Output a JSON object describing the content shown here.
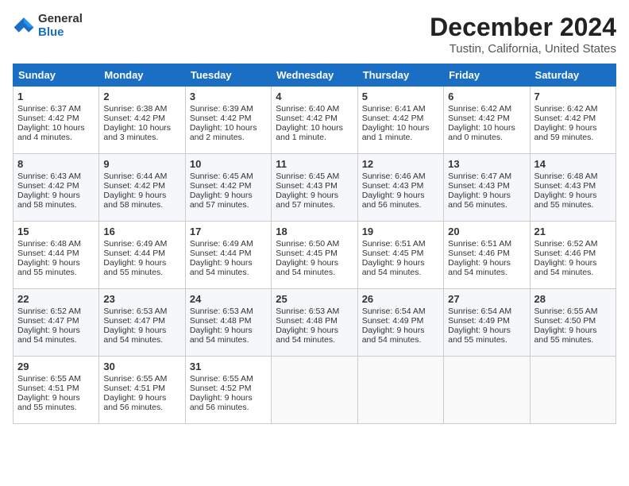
{
  "header": {
    "logo_general": "General",
    "logo_blue": "Blue",
    "title": "December 2024",
    "subtitle": "Tustin, California, United States"
  },
  "days_of_week": [
    "Sunday",
    "Monday",
    "Tuesday",
    "Wednesday",
    "Thursday",
    "Friday",
    "Saturday"
  ],
  "weeks": [
    [
      {
        "day": "1",
        "sunrise": "6:37 AM",
        "sunset": "4:42 PM",
        "daylight": "10 hours and 4 minutes."
      },
      {
        "day": "2",
        "sunrise": "6:38 AM",
        "sunset": "4:42 PM",
        "daylight": "10 hours and 3 minutes."
      },
      {
        "day": "3",
        "sunrise": "6:39 AM",
        "sunset": "4:42 PM",
        "daylight": "10 hours and 2 minutes."
      },
      {
        "day": "4",
        "sunrise": "6:40 AM",
        "sunset": "4:42 PM",
        "daylight": "10 hours and 1 minute."
      },
      {
        "day": "5",
        "sunrise": "6:41 AM",
        "sunset": "4:42 PM",
        "daylight": "10 hours and 1 minute."
      },
      {
        "day": "6",
        "sunrise": "6:42 AM",
        "sunset": "4:42 PM",
        "daylight": "10 hours and 0 minutes."
      },
      {
        "day": "7",
        "sunrise": "6:42 AM",
        "sunset": "4:42 PM",
        "daylight": "9 hours and 59 minutes."
      }
    ],
    [
      {
        "day": "8",
        "sunrise": "6:43 AM",
        "sunset": "4:42 PM",
        "daylight": "9 hours and 58 minutes."
      },
      {
        "day": "9",
        "sunrise": "6:44 AM",
        "sunset": "4:42 PM",
        "daylight": "9 hours and 58 minutes."
      },
      {
        "day": "10",
        "sunrise": "6:45 AM",
        "sunset": "4:42 PM",
        "daylight": "9 hours and 57 minutes."
      },
      {
        "day": "11",
        "sunrise": "6:45 AM",
        "sunset": "4:43 PM",
        "daylight": "9 hours and 57 minutes."
      },
      {
        "day": "12",
        "sunrise": "6:46 AM",
        "sunset": "4:43 PM",
        "daylight": "9 hours and 56 minutes."
      },
      {
        "day": "13",
        "sunrise": "6:47 AM",
        "sunset": "4:43 PM",
        "daylight": "9 hours and 56 minutes."
      },
      {
        "day": "14",
        "sunrise": "6:48 AM",
        "sunset": "4:43 PM",
        "daylight": "9 hours and 55 minutes."
      }
    ],
    [
      {
        "day": "15",
        "sunrise": "6:48 AM",
        "sunset": "4:44 PM",
        "daylight": "9 hours and 55 minutes."
      },
      {
        "day": "16",
        "sunrise": "6:49 AM",
        "sunset": "4:44 PM",
        "daylight": "9 hours and 55 minutes."
      },
      {
        "day": "17",
        "sunrise": "6:49 AM",
        "sunset": "4:44 PM",
        "daylight": "9 hours and 54 minutes."
      },
      {
        "day": "18",
        "sunrise": "6:50 AM",
        "sunset": "4:45 PM",
        "daylight": "9 hours and 54 minutes."
      },
      {
        "day": "19",
        "sunrise": "6:51 AM",
        "sunset": "4:45 PM",
        "daylight": "9 hours and 54 minutes."
      },
      {
        "day": "20",
        "sunrise": "6:51 AM",
        "sunset": "4:46 PM",
        "daylight": "9 hours and 54 minutes."
      },
      {
        "day": "21",
        "sunrise": "6:52 AM",
        "sunset": "4:46 PM",
        "daylight": "9 hours and 54 minutes."
      }
    ],
    [
      {
        "day": "22",
        "sunrise": "6:52 AM",
        "sunset": "4:47 PM",
        "daylight": "9 hours and 54 minutes."
      },
      {
        "day": "23",
        "sunrise": "6:53 AM",
        "sunset": "4:47 PM",
        "daylight": "9 hours and 54 minutes."
      },
      {
        "day": "24",
        "sunrise": "6:53 AM",
        "sunset": "4:48 PM",
        "daylight": "9 hours and 54 minutes."
      },
      {
        "day": "25",
        "sunrise": "6:53 AM",
        "sunset": "4:48 PM",
        "daylight": "9 hours and 54 minutes."
      },
      {
        "day": "26",
        "sunrise": "6:54 AM",
        "sunset": "4:49 PM",
        "daylight": "9 hours and 54 minutes."
      },
      {
        "day": "27",
        "sunrise": "6:54 AM",
        "sunset": "4:49 PM",
        "daylight": "9 hours and 55 minutes."
      },
      {
        "day": "28",
        "sunrise": "6:55 AM",
        "sunset": "4:50 PM",
        "daylight": "9 hours and 55 minutes."
      }
    ],
    [
      {
        "day": "29",
        "sunrise": "6:55 AM",
        "sunset": "4:51 PM",
        "daylight": "9 hours and 55 minutes."
      },
      {
        "day": "30",
        "sunrise": "6:55 AM",
        "sunset": "4:51 PM",
        "daylight": "9 hours and 56 minutes."
      },
      {
        "day": "31",
        "sunrise": "6:55 AM",
        "sunset": "4:52 PM",
        "daylight": "9 hours and 56 minutes."
      },
      null,
      null,
      null,
      null
    ]
  ],
  "labels": {
    "sunrise": "Sunrise:",
    "sunset": "Sunset:",
    "daylight": "Daylight:"
  }
}
